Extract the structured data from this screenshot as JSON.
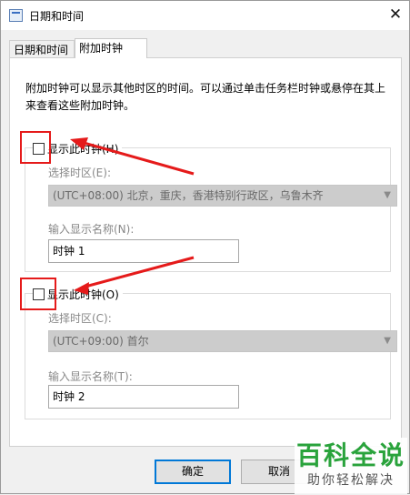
{
  "window": {
    "title": "日期和时间",
    "close_glyph": "✕"
  },
  "tabs": [
    {
      "label": "日期和时间",
      "active": false
    },
    {
      "label": "附加时钟",
      "active": true
    }
  ],
  "description": "附加时钟可以显示其他时区的时间。可以通过单击任务栏时钟或悬停在其上来查看这些附加时钟。",
  "clock1": {
    "checkbox_label": "显示此时钟(H)",
    "checked": false,
    "timezone_label": "选择时区(E):",
    "timezone_value": "(UTC+08:00) 北京，重庆，香港特别行政区，乌鲁木齐",
    "name_label": "输入显示名称(N):",
    "name_value": "时钟 1"
  },
  "clock2": {
    "checkbox_label": "显示此时钟(O)",
    "checked": false,
    "timezone_label": "选择时区(C):",
    "timezone_value": "(UTC+09:00) 首尔",
    "name_label": "输入显示名称(T):",
    "name_value": "时钟 2"
  },
  "buttons": {
    "ok": "确定",
    "cancel": "取消"
  },
  "watermark": {
    "main": "百科全说",
    "sub": "助你轻松解决"
  },
  "colors": {
    "annotation_red": "#e51a1a",
    "accent_blue": "#0078d7",
    "watermark_green": "#2aa33c"
  }
}
